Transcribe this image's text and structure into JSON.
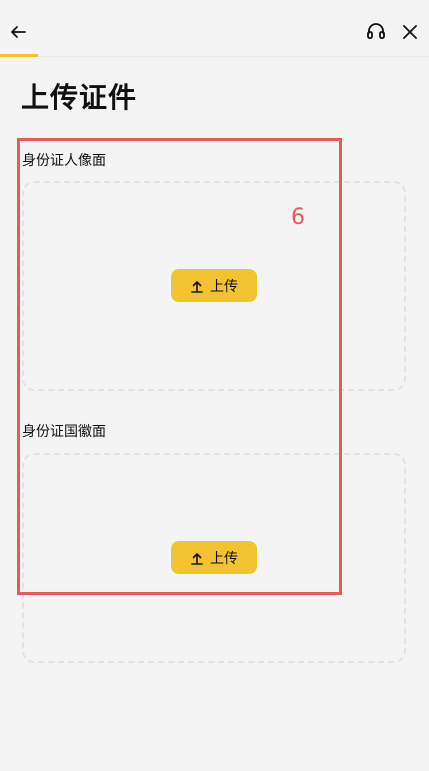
{
  "header": {
    "back_icon": "arrow-left-icon",
    "support_icon": "headset-icon",
    "close_icon": "close-icon",
    "progress_color": "#f2c230"
  },
  "page": {
    "title": "上传证件"
  },
  "sections": [
    {
      "label": "身份证人像面",
      "button_label": "上传",
      "button_icon": "upload-arrow-icon"
    },
    {
      "label": "身份证国徽面",
      "button_label": "上传",
      "button_icon": "upload-arrow-icon"
    }
  ],
  "annotation": {
    "number": "6",
    "color": "#e55a5a"
  },
  "colors": {
    "accent": "#f2c230",
    "background": "#f4f4f4"
  }
}
